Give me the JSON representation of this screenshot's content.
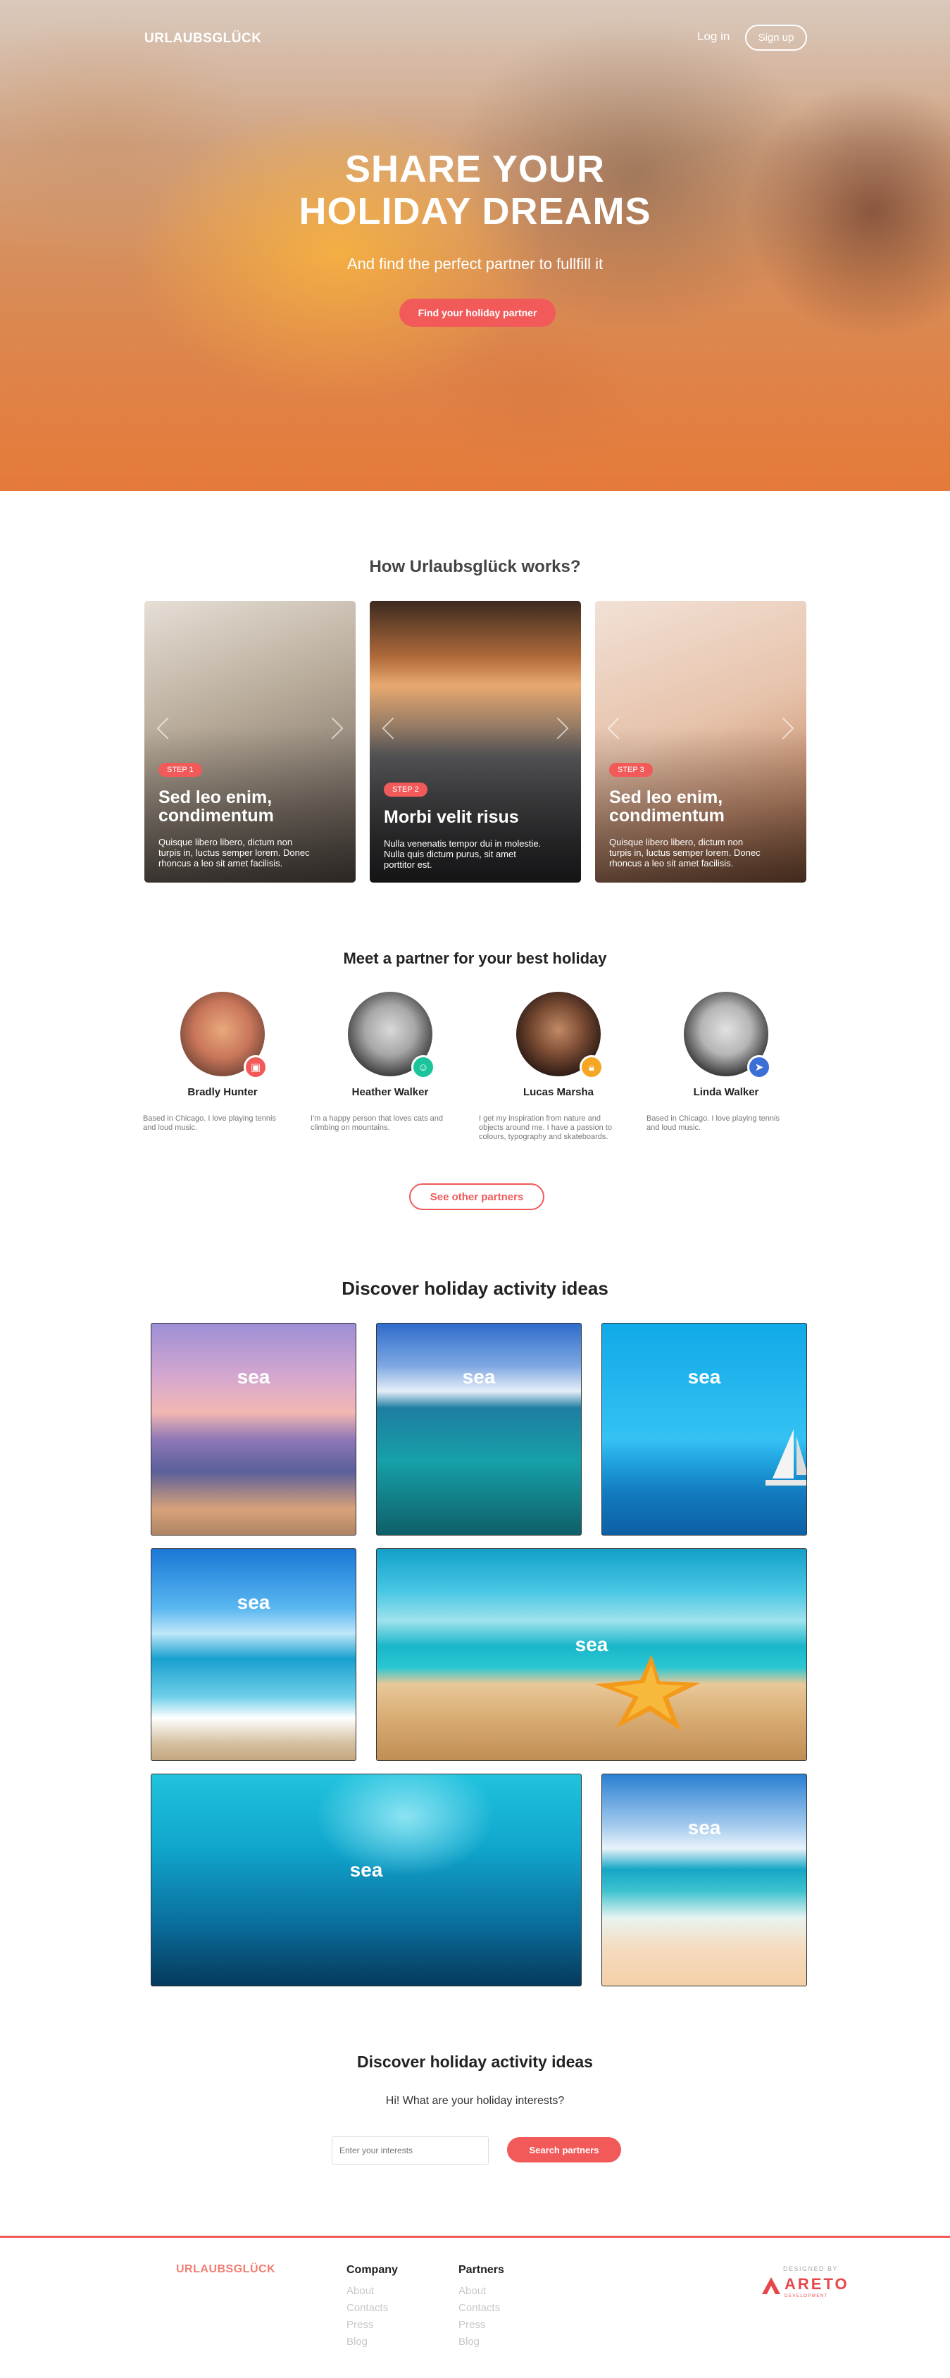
{
  "header": {
    "logo": "URLAUBSGLÜCK",
    "login": "Log in",
    "signup": "Sign up"
  },
  "hero": {
    "title_line1": "SHARE YOUR",
    "title_line2": "HOLIDAY DREAMS",
    "subtitle": "And find the perfect partner to fullfill it",
    "cta": "Find your holiday partner"
  },
  "how": {
    "title": "How Urlaubsglück works?",
    "steps": [
      {
        "badge": "STEP 1",
        "title_line1": "Sed leo enim,",
        "title_line2": "condimentum",
        "text_lines": [
          "Quisque libero libero, dictum non",
          "turpis in, luctus semper lorem. Donec",
          "rhoncus a leo sit amet facilisis."
        ]
      },
      {
        "badge": "STEP 2",
        "title_line1": "Morbi velit risus",
        "title_line2": "",
        "text_lines": [
          "Nulla venenatis tempor dui in molestie.",
          "Nulla quis dictum purus, sit amet",
          "porttitor est."
        ]
      },
      {
        "badge": "STEP 3",
        "title_line1": "Sed leo enim,",
        "title_line2": "condimentum",
        "text_lines": [
          "Quisque libero libero, dictum non",
          "turpis in, luctus semper lorem. Donec",
          "rhoncus a leo sit amet facilisis."
        ]
      }
    ]
  },
  "partners": {
    "title": "Meet a partner for your best holiday",
    "items": [
      {
        "name": "Bradly Hunter",
        "bio_lines": [
          "Based in Chicago. I love playing tennis",
          "and loud music."
        ],
        "status_icon": "camera-icon",
        "status_color": "#f25a5a"
      },
      {
        "name": "Heather Walker",
        "bio_lines": [
          "I'm a happy person that loves cats and",
          "climbing on mountains."
        ],
        "status_icon": "smile-icon",
        "status_color": "#1bc49b"
      },
      {
        "name": "Lucas Marsha",
        "bio_lines": [
          "I get my inspiration from nature and",
          "objects around me. I have a passion to",
          "colours, typography and skateboards."
        ],
        "status_icon": "lock-icon",
        "status_color": "#f5a623"
      },
      {
        "name": "Linda Walker",
        "bio_lines": [
          "Based in Chicago. I love playing tennis",
          "and loud music."
        ],
        "status_icon": "send-icon",
        "status_color": "#3b6fd6"
      }
    ],
    "more": "See other partners"
  },
  "activities": {
    "title": "Discover holiday activity ideas",
    "tiles": [
      "sea",
      "sea",
      "sea",
      "sea",
      "sea",
      "sea",
      "sea"
    ]
  },
  "search": {
    "title": "Discover holiday activity ideas",
    "question": "Hi! What are your holiday interests?",
    "placeholder": "Enter your interests",
    "button": "Search partners"
  },
  "footer": {
    "logo": "URLAUBSGLÜCK",
    "company": {
      "title": "Company",
      "links": [
        "About",
        "Contacts",
        "Press",
        "Blog"
      ]
    },
    "partners": {
      "title": "Partners",
      "links": [
        "About",
        "Contacts",
        "Press",
        "Blog"
      ]
    },
    "designed_by": "DESIGNED BY",
    "brand": "ARETO",
    "brand_sub": "DEVELOPMENT"
  },
  "colors": {
    "accent": "#f25a5a",
    "footer_logo": "#f27d72",
    "brand": "#e8454a"
  }
}
